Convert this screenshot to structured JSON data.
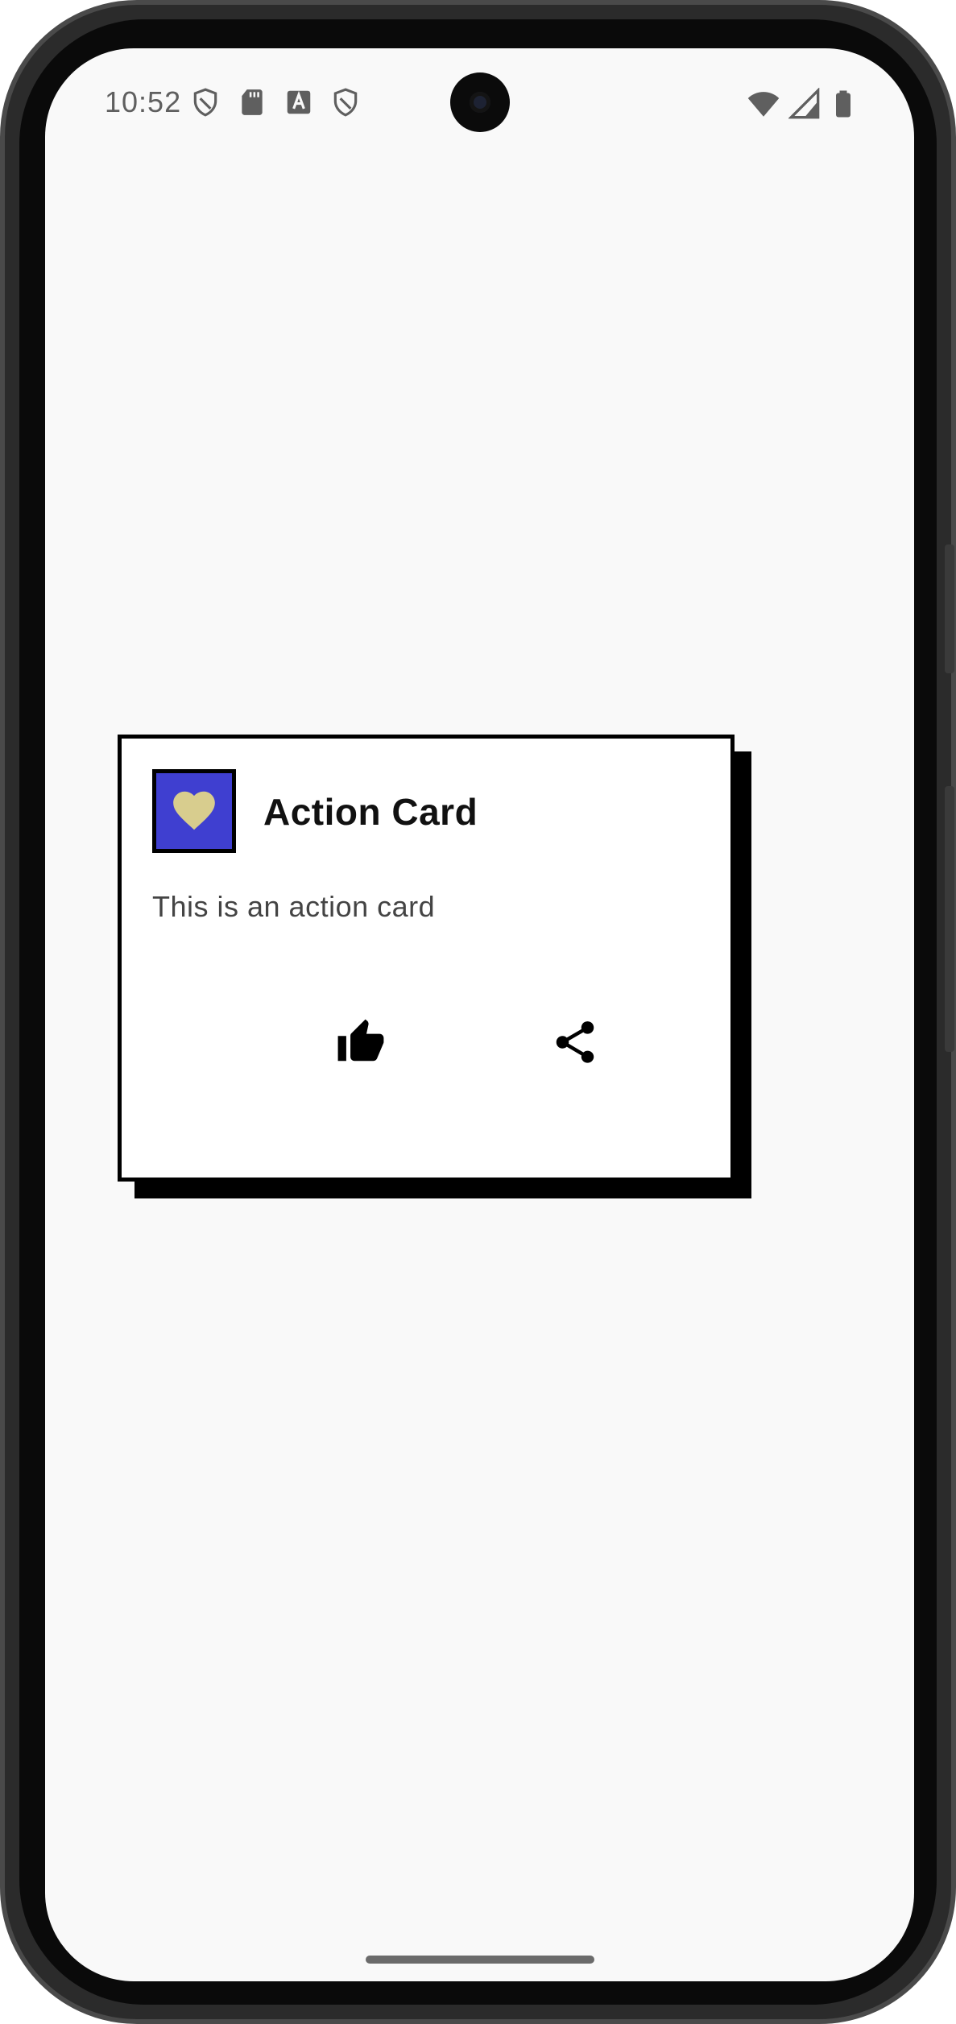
{
  "status_bar": {
    "time": "10:52",
    "left_icons": [
      "shield-icon",
      "sd-card-icon",
      "font-a-icon",
      "shield-icon"
    ],
    "right_icons": [
      "wifi-icon",
      "cellular-signal-icon",
      "battery-icon"
    ]
  },
  "card": {
    "title": "Action Card",
    "body": "This is an action card",
    "avatar_icon": "heart-icon",
    "avatar_color": "#3f3fd0",
    "heart_color": "#d8cd8e",
    "actions": [
      {
        "icon": "thumb-up-icon"
      },
      {
        "icon": "share-icon"
      }
    ]
  }
}
